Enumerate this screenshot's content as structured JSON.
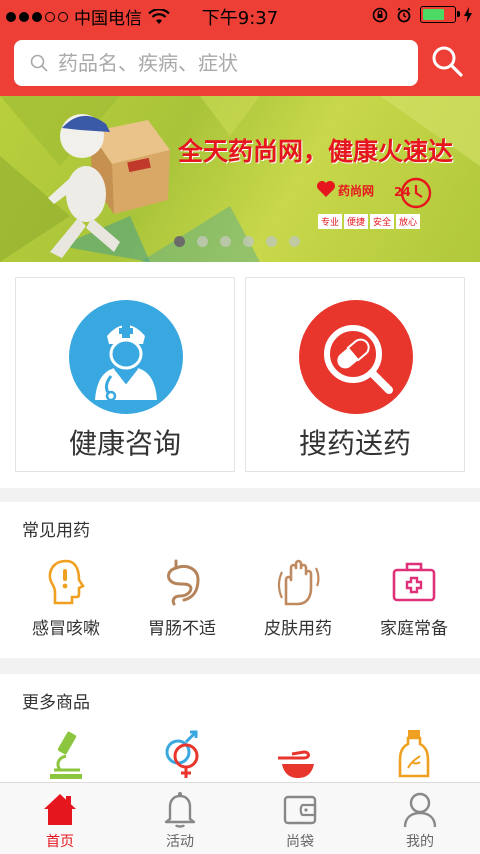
{
  "status_bar": {
    "carrier": "中国电信",
    "time": "下午9:37"
  },
  "search": {
    "placeholder": "药品名、疾病、症状"
  },
  "banner": {
    "headline": "全天药尚网，健康火速达",
    "logo_text": "药尚网",
    "tags": [
      "专业",
      "便捷",
      "安全",
      "放心"
    ],
    "slide_count": 6,
    "active_slide": 0
  },
  "services": [
    {
      "label": "健康咨询",
      "color": "#3aa8e0",
      "icon": "doctor-icon"
    },
    {
      "label": "搜药送药",
      "color": "#e8362d",
      "icon": "pill-search-icon"
    }
  ],
  "common_meds": {
    "title": "常见用药",
    "items": [
      {
        "label": "感冒咳嗽",
        "icon": "head-cold-icon",
        "color": "#f0a020"
      },
      {
        "label": "胃肠不适",
        "icon": "stomach-icon",
        "color": "#b5845a"
      },
      {
        "label": "皮肤用药",
        "icon": "hand-skin-icon",
        "color": "#c08a60"
      },
      {
        "label": "家庭常备",
        "icon": "first-aid-kit-icon",
        "color": "#e0307a"
      }
    ]
  },
  "more_products": {
    "title": "更多商品",
    "items": [
      {
        "icon": "microscope-icon",
        "color": "#8cc63f"
      },
      {
        "icon": "gender-icon",
        "color": "#3aa8e0"
      },
      {
        "icon": "spoon-bowl-icon",
        "color": "#e8362d"
      },
      {
        "icon": "herbal-bottle-icon",
        "color": "#f0a020"
      }
    ]
  },
  "tabbar": {
    "tabs": [
      {
        "label": "首页",
        "icon": "home-icon",
        "active": true
      },
      {
        "label": "活动",
        "icon": "bell-icon",
        "active": false
      },
      {
        "label": "尚袋",
        "icon": "wallet-icon",
        "active": false
      },
      {
        "label": "我的",
        "icon": "user-icon",
        "active": false
      }
    ]
  },
  "colors": {
    "brand_red": "#ee3f37",
    "active_tab": "#e6161e"
  }
}
